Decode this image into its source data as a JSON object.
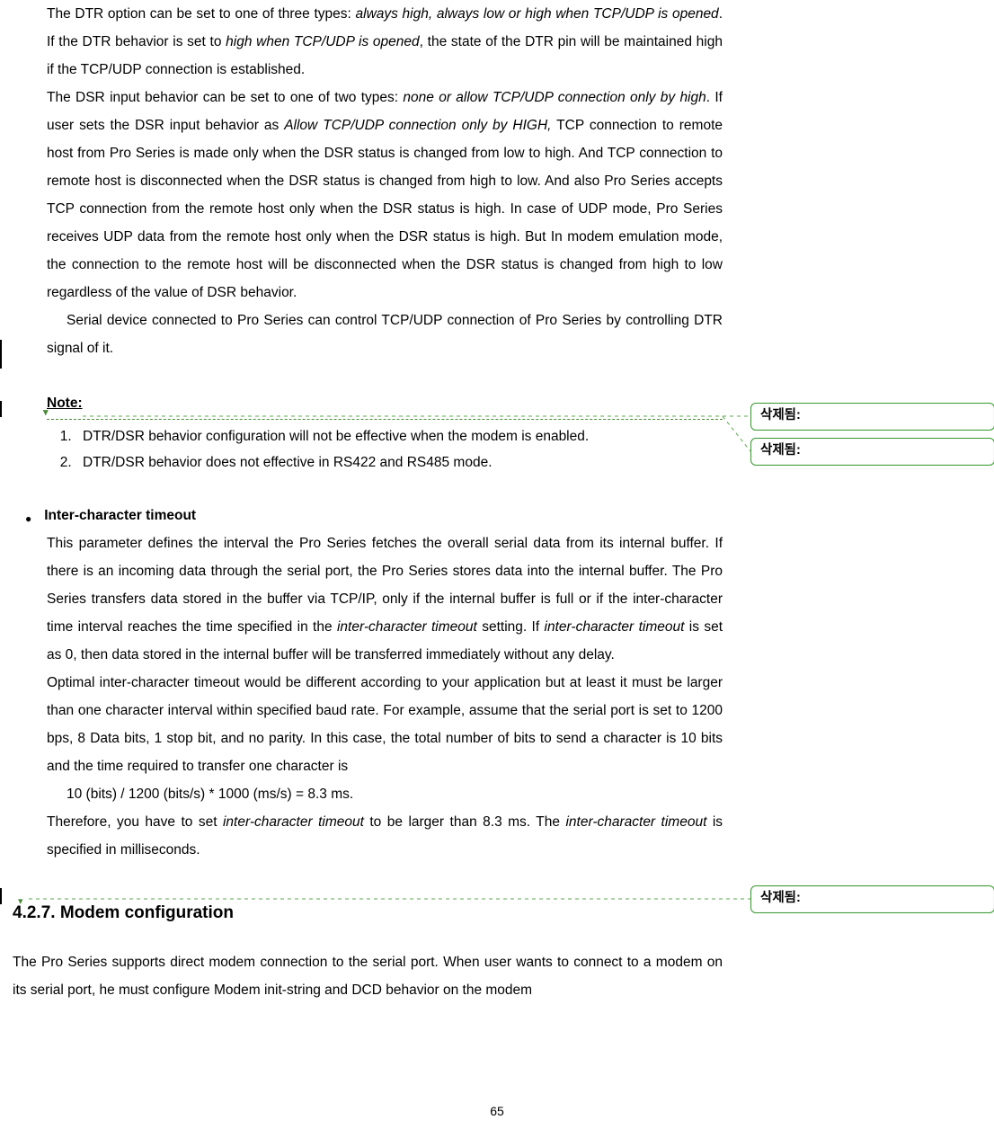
{
  "p1": {
    "s1a": "The DTR option can be set to one of three types: ",
    "s1b": "always high, always low or high when TCP/UDP is opened",
    "s1c": ". If the DTR behavior is set to ",
    "s1d": "high when TCP/UDP is opened",
    "s1e": ", the state of the DTR pin will be maintained high if the TCP/UDP connection is established."
  },
  "p2": {
    "s2a": "The DSR input behavior can be set to one of two types: ",
    "s2b": "none or allow TCP/UDP connection only by high",
    "s2c": ". If user sets the DSR input behavior as ",
    "s2d": "Allow TCP/UDP connection only by HIGH,",
    "s2e": " TCP connection to remote host from Pro Series is made only when the DSR status is changed from low to high. And TCP connection to remote host is disconnected when the DSR status is changed from high to low. And also Pro Series accepts TCP connection from the remote host only when the DSR status is high. In case of UDP mode, Pro Series receives UDP data from the remote host only when the DSR status is high. But In modem emulation mode, the connection to the remote host will be disconnected when the DSR status is changed from high to low regardless of the value of DSR behavior."
  },
  "p3": "Serial device connected to Pro Series can control TCP/UDP connection of Pro Series by controlling DTR signal of it.",
  "note": {
    "heading": "Note:",
    "i1": "DTR/DSR behavior configuration will not be effective when the modem is enabled.",
    "i2": "DTR/DSR behavior does not effective in RS422 and RS485 mode."
  },
  "ict": {
    "title": "Inter-character timeout",
    "b1a": "This parameter defines the interval the Pro Series fetches the overall serial data from its internal buffer. If there is an incoming data through the serial port, the Pro Series stores data into the internal buffer. The Pro Series transfers data stored in the buffer via TCP/IP, only if the internal buffer is full or if the inter-character time interval reaches the time specified in the ",
    "b1b": "inter-character timeout",
    "b1c": " setting. If ",
    "b1d": "inter-character timeout",
    "b1e": " is set as 0, then data stored in the internal buffer will be transferred immediately without any delay.",
    "b2": "Optimal inter-character timeout would be different according to your application but at least it must be larger than one character interval within specified baud rate. For example, assume that the serial port is set to 1200 bps, 8 Data bits, 1 stop bit, and no parity. In this case, the total number of bits to send a character is 10 bits and the time required to transfer one character is",
    "calc": "10 (bits) / 1200 (bits/s) * 1000 (ms/s) = 8.3 ms.",
    "b3a": "Therefore, you have to set ",
    "b3b": "inter-character timeout",
    "b3c": " to be larger than 8.3 ms. The ",
    "b3d": "inter-character timeout",
    "b3e": " is specified in milliseconds."
  },
  "section": {
    "h": "4.2.7. Modem configuration",
    "intro": "The Pro Series supports direct modem connection to the serial port. When user wants to connect to a modem on its serial port, he must configure Modem init-string and DCD behavior on the modem"
  },
  "comments": {
    "label": "삭제됨:",
    "c1": " ",
    "c2": " ",
    "c3": " "
  },
  "pagenum": "65"
}
